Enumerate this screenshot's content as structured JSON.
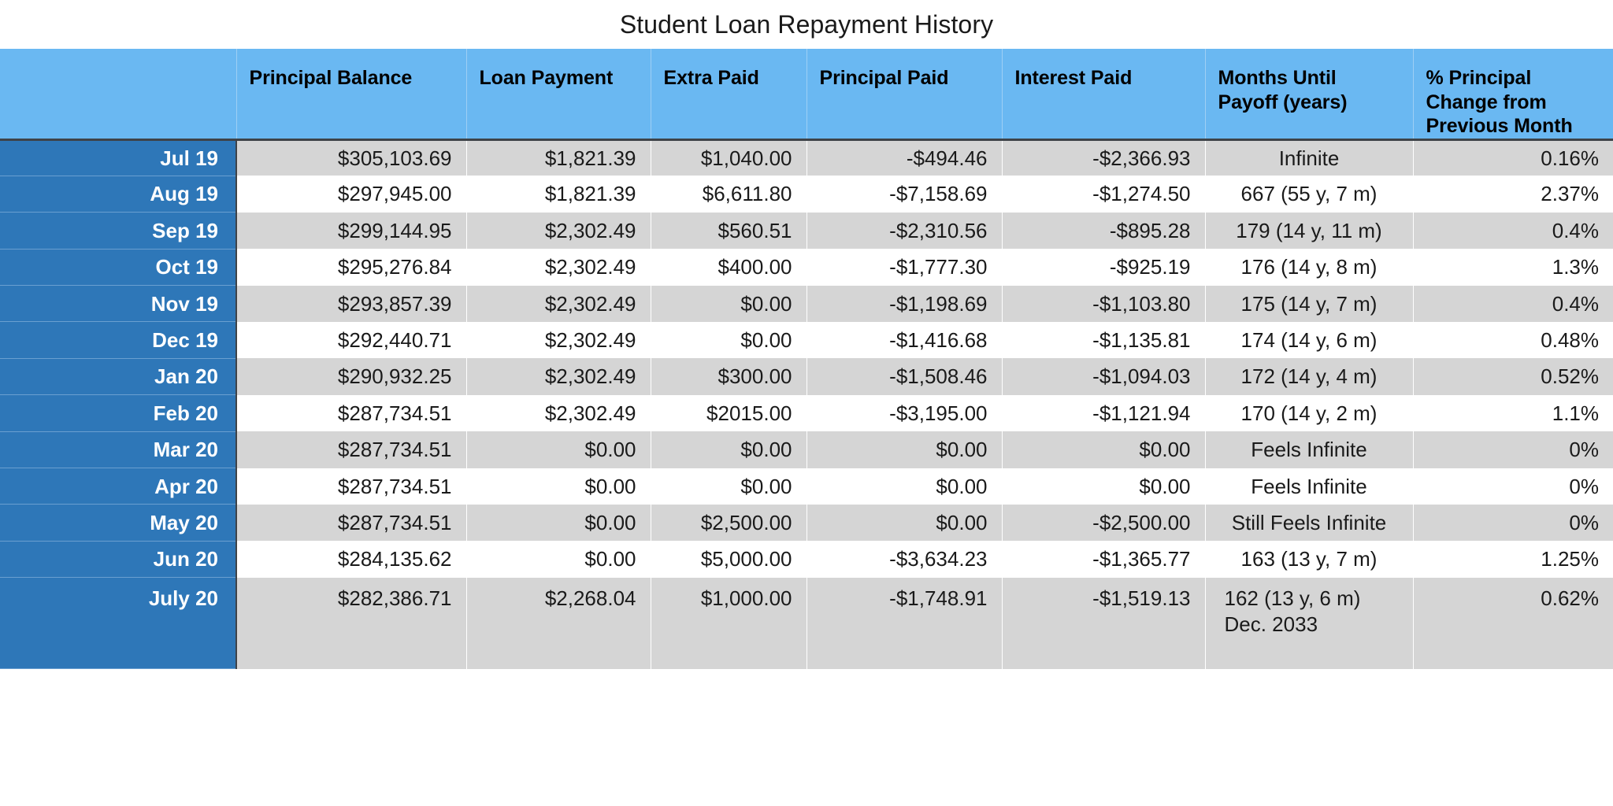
{
  "title": "Student Loan Repayment History",
  "colors": {
    "header_blue": "#6ab8f2",
    "label_blue": "#2e77b8",
    "row_stripe": "#d5d5d5",
    "row_plain": "#ffffff",
    "header_rule": "#3e4348"
  },
  "table": {
    "corner_header": "",
    "columns": [
      "Principal Balance",
      "Loan Payment",
      "Extra Paid",
      "Principal Paid",
      "Interest Paid",
      "Months Until Payoff (years)",
      "% Principal Change from Previous Month"
    ],
    "rows": [
      {
        "label": "Jul 19",
        "principal_balance": "$305,103.69",
        "loan_payment": "$1,821.39",
        "extra_paid": "$1,040.00",
        "principal_paid": "-$494.46",
        "interest_paid": "-$2,366.93",
        "months_until_payoff": "Infinite",
        "months_until_payoff_sub": "",
        "pct_principal_change": "0.16%"
      },
      {
        "label": "Aug 19",
        "principal_balance": "$297,945.00",
        "loan_payment": "$1,821.39",
        "extra_paid": "$6,611.80",
        "principal_paid": "-$7,158.69",
        "interest_paid": "-$1,274.50",
        "months_until_payoff": "667 (55 y, 7 m)",
        "months_until_payoff_sub": "",
        "pct_principal_change": "2.37%"
      },
      {
        "label": "Sep 19",
        "principal_balance": "$299,144.95",
        "loan_payment": "$2,302.49",
        "extra_paid": "$560.51",
        "principal_paid": "-$2,310.56",
        "interest_paid": "-$895.28",
        "months_until_payoff": "179 (14 y, 11 m)",
        "months_until_payoff_sub": "",
        "pct_principal_change": "0.4%"
      },
      {
        "label": "Oct 19",
        "principal_balance": "$295,276.84",
        "loan_payment": "$2,302.49",
        "extra_paid": "$400.00",
        "principal_paid": "-$1,777.30",
        "interest_paid": "-$925.19",
        "months_until_payoff": "176 (14 y, 8 m)",
        "months_until_payoff_sub": "",
        "pct_principal_change": "1.3%"
      },
      {
        "label": "Nov 19",
        "principal_balance": "$293,857.39",
        "loan_payment": "$2,302.49",
        "extra_paid": "$0.00",
        "principal_paid": "-$1,198.69",
        "interest_paid": "-$1,103.80",
        "months_until_payoff": "175 (14 y, 7 m)",
        "months_until_payoff_sub": "",
        "pct_principal_change": "0.4%"
      },
      {
        "label": "Dec 19",
        "principal_balance": "$292,440.71",
        "loan_payment": "$2,302.49",
        "extra_paid": "$0.00",
        "principal_paid": "-$1,416.68",
        "interest_paid": "-$1,135.81",
        "months_until_payoff": "174 (14 y, 6 m)",
        "months_until_payoff_sub": "",
        "pct_principal_change": "0.48%"
      },
      {
        "label": "Jan 20",
        "principal_balance": "$290,932.25",
        "loan_payment": "$2,302.49",
        "extra_paid": "$300.00",
        "principal_paid": "-$1,508.46",
        "interest_paid": "-$1,094.03",
        "months_until_payoff": "172 (14 y, 4 m)",
        "months_until_payoff_sub": "",
        "pct_principal_change": "0.52%"
      },
      {
        "label": "Feb 20",
        "principal_balance": "$287,734.51",
        "loan_payment": "$2,302.49",
        "extra_paid": "$2015.00",
        "principal_paid": "-$3,195.00",
        "interest_paid": "-$1,121.94",
        "months_until_payoff": "170 (14 y, 2 m)",
        "months_until_payoff_sub": "",
        "pct_principal_change": "1.1%"
      },
      {
        "label": "Mar 20",
        "principal_balance": "$287,734.51",
        "loan_payment": "$0.00",
        "extra_paid": "$0.00",
        "principal_paid": "$0.00",
        "interest_paid": "$0.00",
        "months_until_payoff": "Feels Infinite",
        "months_until_payoff_sub": "",
        "pct_principal_change": "0%"
      },
      {
        "label": "Apr 20",
        "principal_balance": "$287,734.51",
        "loan_payment": "$0.00",
        "extra_paid": "$0.00",
        "principal_paid": "$0.00",
        "interest_paid": "$0.00",
        "months_until_payoff": "Feels Infinite",
        "months_until_payoff_sub": "",
        "pct_principal_change": "0%"
      },
      {
        "label": "May 20",
        "principal_balance": "$287,734.51",
        "loan_payment": "$0.00",
        "extra_paid": "$2,500.00",
        "principal_paid": "$0.00",
        "interest_paid": "-$2,500.00",
        "months_until_payoff": "Still Feels Infinite",
        "months_until_payoff_sub": "",
        "pct_principal_change": "0%"
      },
      {
        "label": "Jun 20",
        "principal_balance": "$284,135.62",
        "loan_payment": "$0.00",
        "extra_paid": "$5,000.00",
        "principal_paid": "-$3,634.23",
        "interest_paid": "-$1,365.77",
        "months_until_payoff": "163 (13 y, 7 m)",
        "months_until_payoff_sub": "",
        "pct_principal_change": "1.25%"
      },
      {
        "label": "July 20",
        "principal_balance": "$282,386.71",
        "loan_payment": "$2,268.04",
        "extra_paid": "$1,000.00",
        "principal_paid": "-$1,748.91",
        "interest_paid": "-$1,519.13",
        "months_until_payoff": "162 (13 y, 6 m)",
        "months_until_payoff_sub": "Dec. 2033",
        "pct_principal_change": "0.62%"
      }
    ]
  }
}
